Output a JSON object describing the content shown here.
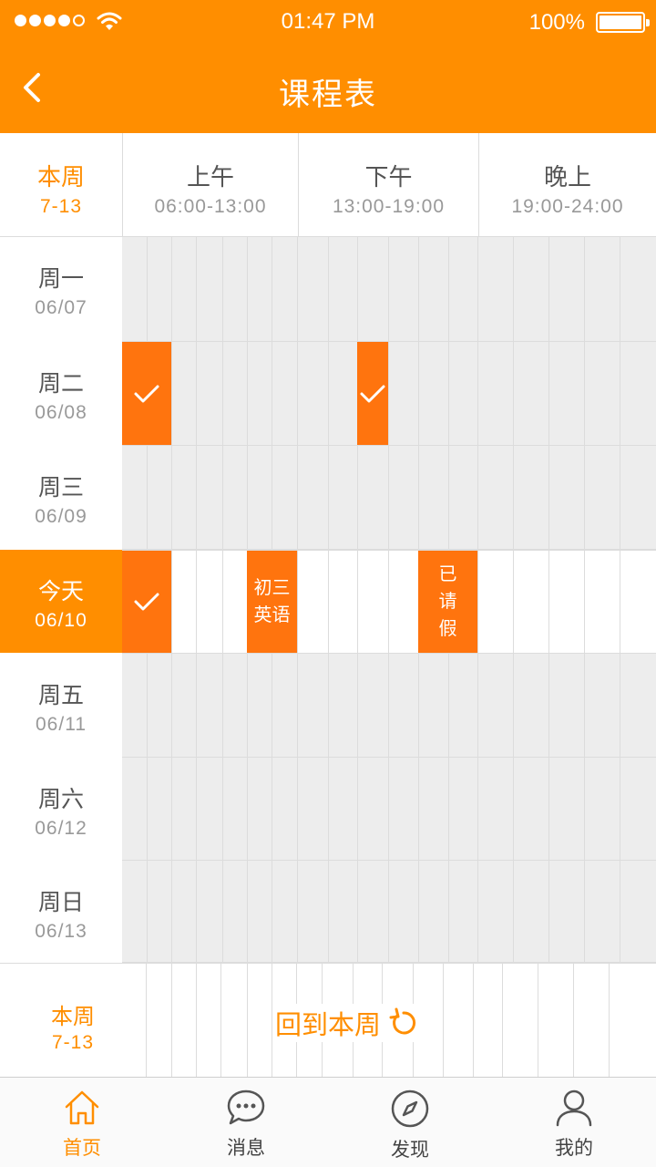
{
  "status_bar": {
    "time": "01:47 PM",
    "battery": "100%"
  },
  "nav": {
    "title": "课程表"
  },
  "header": {
    "week_label": "本周",
    "week_range": "7-13",
    "periods": [
      {
        "name": "上午",
        "time": "06:00-13:00"
      },
      {
        "name": "下午",
        "time": "13:00-19:00"
      },
      {
        "name": "晚上",
        "time": "19:00-24:00"
      }
    ]
  },
  "days": [
    {
      "name": "周一",
      "date": "06/07"
    },
    {
      "name": "周二",
      "date": "06/08"
    },
    {
      "name": "周三",
      "date": "06/09"
    },
    {
      "name": "今天",
      "date": "06/10"
    },
    {
      "name": "周五",
      "date": "06/11"
    },
    {
      "name": "周六",
      "date": "06/12"
    },
    {
      "name": "周日",
      "date": "06/13"
    }
  ],
  "courses": {
    "english_line1": "初三",
    "english_line2": "英语",
    "leave": "已请假"
  },
  "footer": {
    "week_label": "本周",
    "week_range": "7-13",
    "back_label": "回到本周"
  },
  "tabs": [
    {
      "label": "首页"
    },
    {
      "label": "消息"
    },
    {
      "label": "发现"
    },
    {
      "label": "我的"
    }
  ],
  "colors": {
    "accent": "#ff8e00",
    "block": "#ff740e"
  }
}
